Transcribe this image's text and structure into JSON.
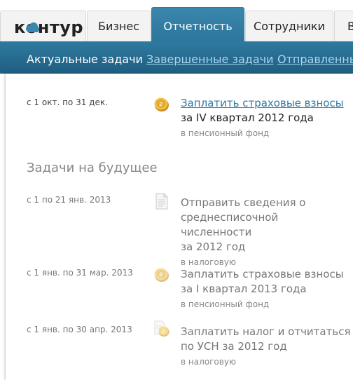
{
  "logo": {
    "text": "контур"
  },
  "nav": {
    "tabs": [
      {
        "label": "Бизнес"
      },
      {
        "label": "Отчетность"
      },
      {
        "label": "Сотрудники"
      },
      {
        "label": "В"
      }
    ]
  },
  "subnav": {
    "tabs": [
      {
        "label": "Актуальные задачи"
      },
      {
        "label": "Завершенные задачи"
      },
      {
        "label": "Отправленные"
      }
    ]
  },
  "current_task": {
    "date": "с 1 окт. по 31 дек.",
    "link": "Заплатить страховые взносы",
    "line2": "за IV квартал 2012 года",
    "recipient": "в пенсионный фонд"
  },
  "future": {
    "title": "Задачи на будущее",
    "tasks": [
      {
        "date": "с 1 по 21 янв. 2013",
        "lines": [
          "Отправить сведения о",
          "среднесписочной численности",
          "за 2012 год"
        ],
        "recipient": "в налоговую"
      },
      {
        "date": "с 1 янв. по 31 мар. 2013",
        "lines": [
          "Заплатить страховые взносы",
          "за I квартал 2013 года"
        ],
        "recipient": "в пенсионный фонд"
      },
      {
        "date": "с 1 янв. по 30 апр. 2013",
        "lines": [
          "Заплатить налог и отчитаться",
          "по УСН за 2012 год"
        ],
        "recipient": "в налоговую"
      }
    ]
  },
  "colors": {
    "nav_active": "#2d789e",
    "subnav_bg": "#1f5e80",
    "link": "#2d7aa3",
    "coin": "#e0a92a"
  },
  "icons": [
    "cloud-logo-icon",
    "coin-icon",
    "document-icon",
    "document-coin-icon"
  ]
}
